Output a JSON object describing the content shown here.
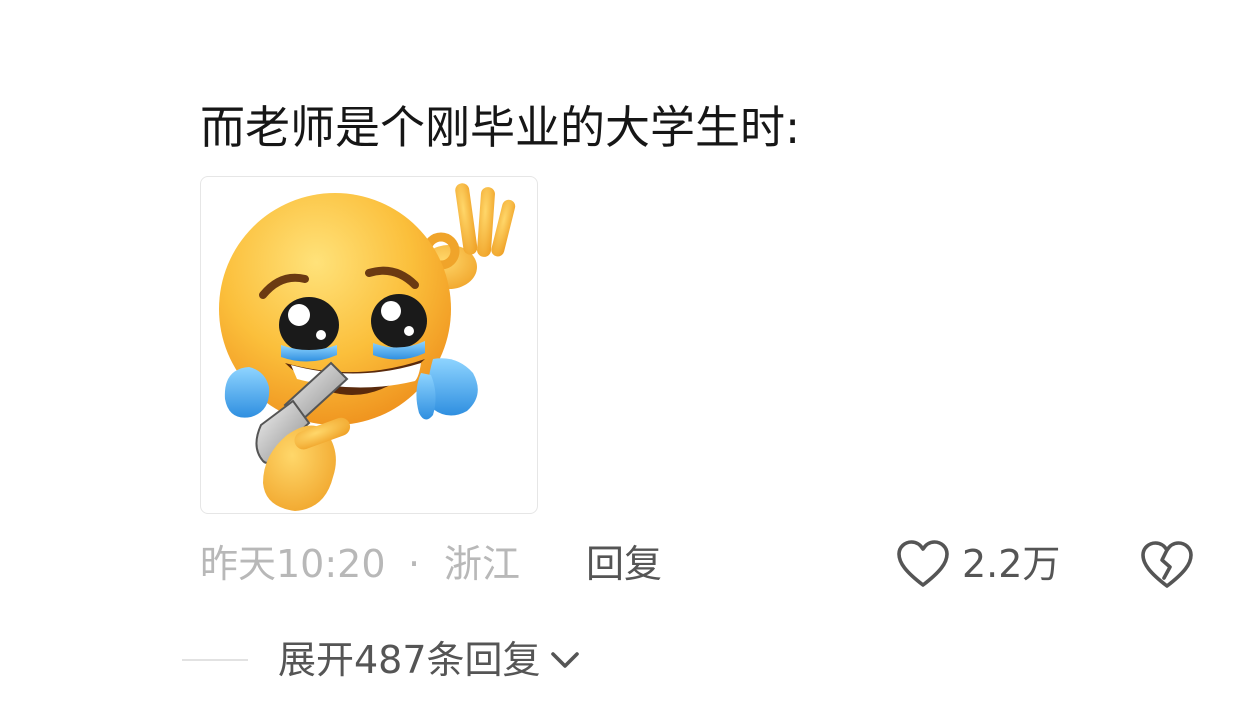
{
  "comment": {
    "text": "而老师是个刚毕业的大学生时:",
    "sticker_icon": "crying-laughing-emoji-with-gun-icon"
  },
  "meta": {
    "time": "昨天10:20",
    "separator": "·",
    "location": "浙江",
    "reply_label": "回复"
  },
  "actions": {
    "like_icon": "heart-outline-icon",
    "like_count": "2.2万",
    "dislike_icon": "broken-heart-icon"
  },
  "replies": {
    "expand_label": "展开487条回复",
    "expand_icon": "chevron-down-icon"
  },
  "colors": {
    "primary_text": "#161616",
    "muted_text": "#b8b8b8",
    "action_text": "#555555"
  }
}
